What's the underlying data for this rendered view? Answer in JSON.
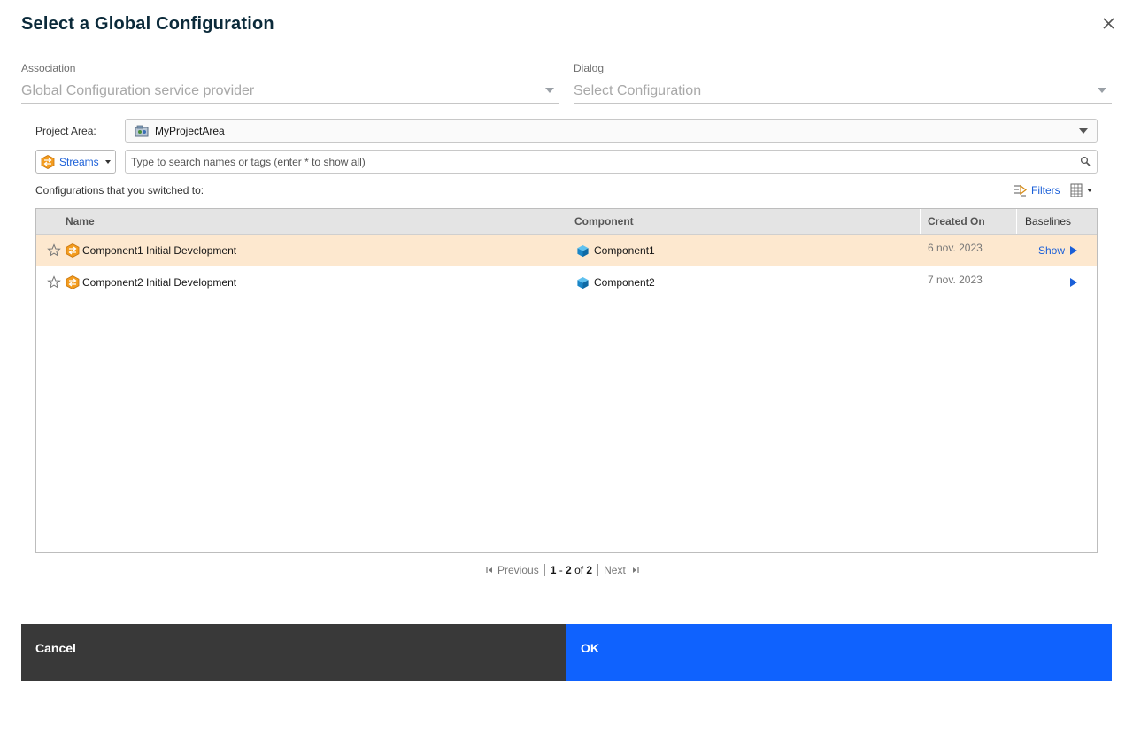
{
  "dialog": {
    "title": "Select a Global Configuration"
  },
  "association": {
    "label": "Association",
    "value": "Global Configuration service provider"
  },
  "dialog_field": {
    "label": "Dialog",
    "value": "Select Configuration"
  },
  "project_area": {
    "label": "Project Area:",
    "value": "MyProjectArea"
  },
  "type_filter": {
    "label": "Streams"
  },
  "search": {
    "placeholder": "Type to search names or tags (enter * to show all)"
  },
  "switched": {
    "label": "Configurations that you switched to:"
  },
  "toolbar": {
    "filters_label": "Filters"
  },
  "grid": {
    "columns": {
      "name": "Name",
      "component": "Component",
      "created_on": "Created On",
      "baselines": "Baselines"
    },
    "rows": [
      {
        "name": "Component1 Initial Development",
        "component": "Component1",
        "created_on": "6 nov. 2023",
        "baselines": "Show",
        "selected": true
      },
      {
        "name": "Component2 Initial Development",
        "component": "Component2",
        "created_on": "7 nov. 2023",
        "baselines": "",
        "selected": false
      }
    ]
  },
  "pager": {
    "previous": "Previous",
    "range_start": "1",
    "range_dash": " - ",
    "range_end": "2",
    "of": " of ",
    "total": "2",
    "next": "Next"
  },
  "footer": {
    "cancel_label": "Cancel",
    "ok_label": "OK"
  },
  "colors": {
    "ok": "#0f62fe",
    "cancel": "#393939",
    "selected_row": "#fde8cf",
    "link": "#1a5fd8"
  },
  "icons": [
    "close-icon",
    "chevron-down-icon",
    "project-area-icon",
    "stream-icon",
    "search-icon",
    "filter-icon",
    "columns-icon",
    "star-icon",
    "component-icon",
    "play-arrow-icon",
    "first-page-icon",
    "last-page-icon"
  ]
}
